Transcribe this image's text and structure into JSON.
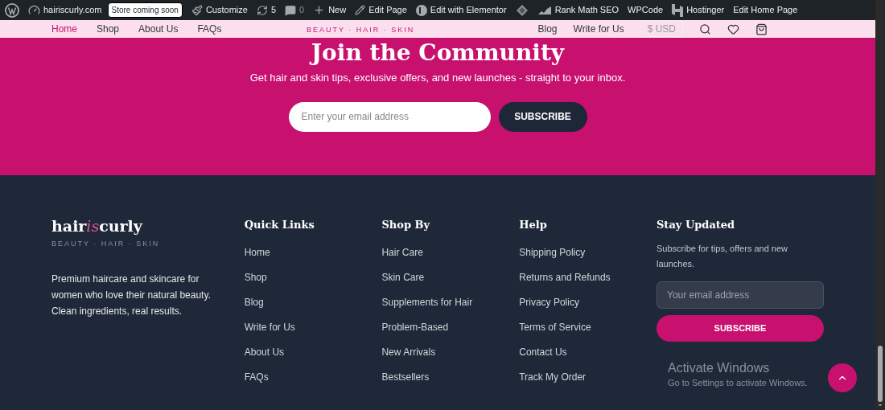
{
  "admin_bar": {
    "site": "hairiscurly.com",
    "badge": "Store coming soon",
    "customize": "Customize",
    "updates": "5",
    "comments": "0",
    "new": "New",
    "edit_page": "Edit Page",
    "elementor": "Edit with Elementor",
    "rank_math": "Rank Math SEO",
    "wpcode": "WPCode",
    "hostinger": "Hostinger",
    "edit_home": "Edit Home Page"
  },
  "header": {
    "nav_left": [
      {
        "label": "Home",
        "selected": true
      },
      {
        "label": "Shop",
        "selected": false
      },
      {
        "label": "About Us",
        "selected": false
      },
      {
        "label": "FAQs",
        "selected": false
      }
    ],
    "tagline": "BEAUTY · HAIR · SKIN",
    "nav_right": [
      "Blog",
      "Write for Us"
    ],
    "currency": "$ USD"
  },
  "newsletter": {
    "title": "Join the Community",
    "subtitle": "Get hair and skin tips, exclusive offers, and new launches - straight to your inbox.",
    "placeholder": "Enter your email address",
    "button": "SUBSCRIBE"
  },
  "footer": {
    "brand": {
      "prefix": "hair",
      "accent": "is",
      "suffix": "curly",
      "tagline": "BEAUTY · HAIR · SKIN",
      "description": "Premium haircare and skincare for women who love their natural beauty. Clean ingredients, real results."
    },
    "columns": [
      {
        "title": "Quick Links",
        "links": [
          "Home",
          "Shop",
          "Blog",
          "Write for Us",
          "About Us",
          "FAQs"
        ]
      },
      {
        "title": "Shop By",
        "links": [
          "Hair Care",
          "Skin Care",
          "Supplements for Hair",
          "Problem-Based",
          "New Arrivals",
          "Bestsellers"
        ]
      },
      {
        "title": "Help",
        "links": [
          "Shipping Policy",
          "Returns and Refunds",
          "Privacy Policy",
          "Terms of Service",
          "Contact Us",
          "Track My Order"
        ]
      }
    ],
    "stay_updated": {
      "title": "Stay Updated",
      "text": "Subscribe for tips, offers and new launches.",
      "placeholder": "Your email address",
      "button": "SUBSCRIBE"
    }
  },
  "windows_notice": {
    "title": "Activate Windows",
    "text": "Go to Settings to activate Windows."
  }
}
